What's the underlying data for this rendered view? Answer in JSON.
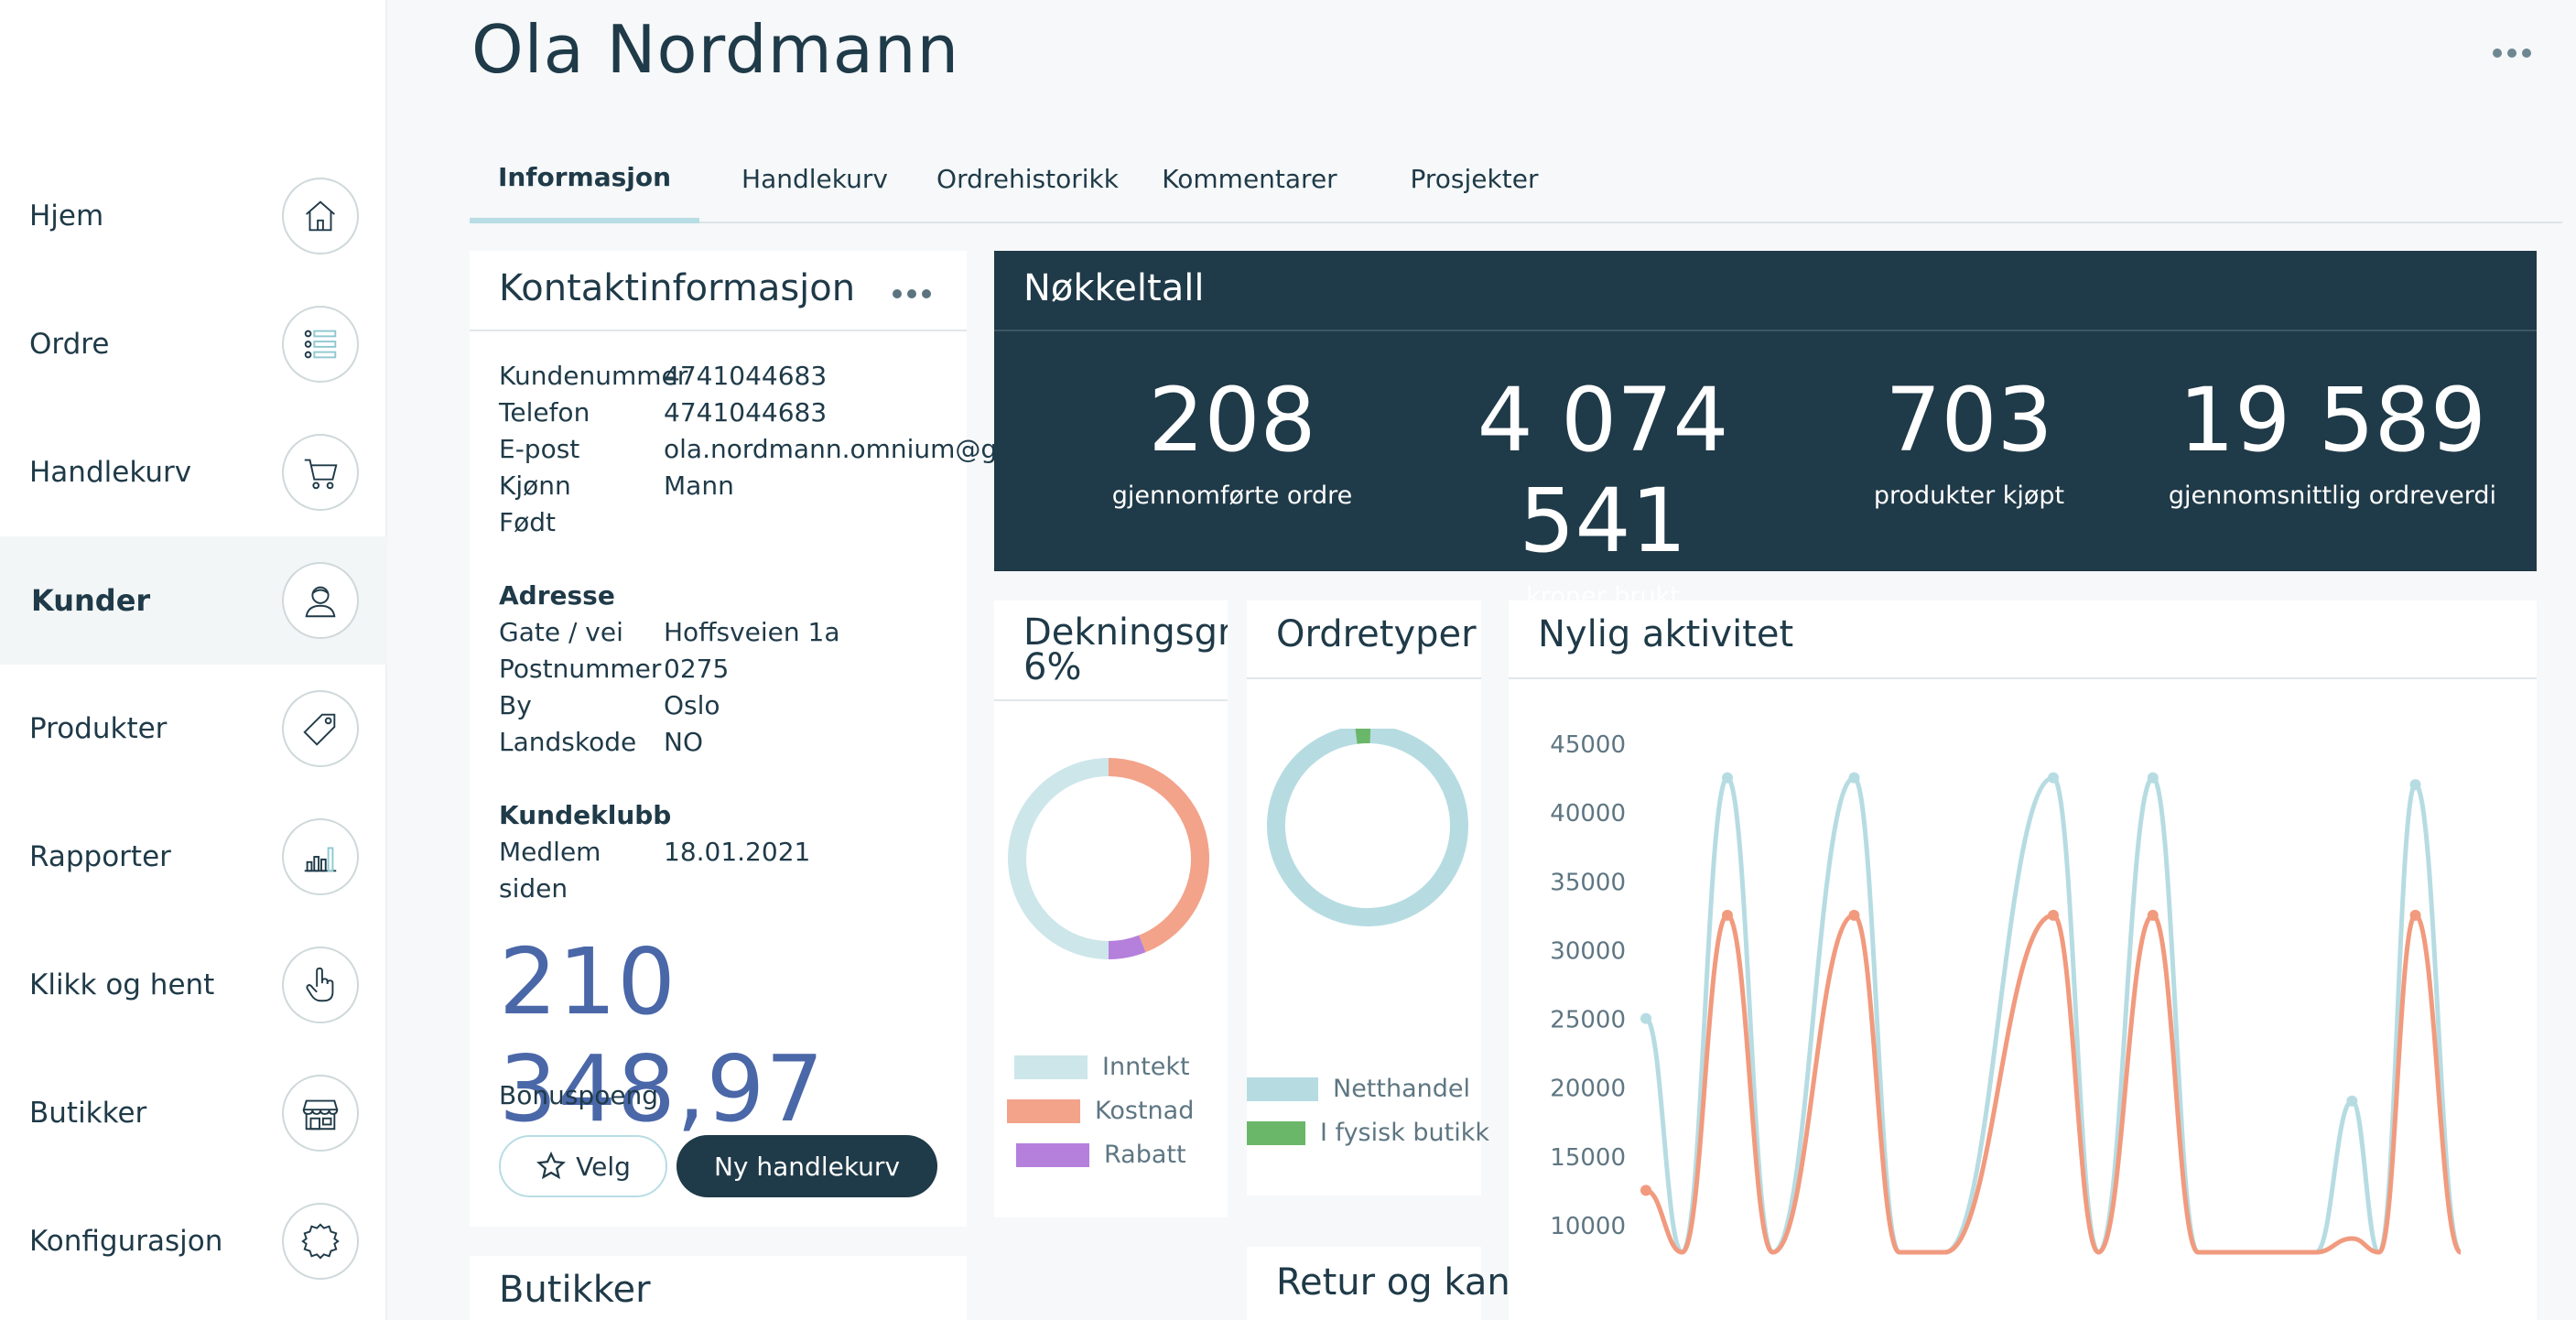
{
  "sidebar": {
    "items": [
      {
        "label": "Hjem",
        "icon": "home-icon"
      },
      {
        "label": "Ordre",
        "icon": "list-icon"
      },
      {
        "label": "Handlekurv",
        "icon": "cart-icon"
      },
      {
        "label": "Kunder",
        "icon": "customer-icon",
        "active": true
      },
      {
        "label": "Produkter",
        "icon": "tag-icon"
      },
      {
        "label": "Rapporter",
        "icon": "bar-chart-icon"
      },
      {
        "label": "Klikk og hent",
        "icon": "hand-pointer-icon"
      },
      {
        "label": "Butikker",
        "icon": "store-icon"
      },
      {
        "label": "Konfigurasjon",
        "icon": "gear-icon"
      }
    ]
  },
  "header": {
    "title": "Ola Nordmann",
    "more_icon": "more-horizontal-icon"
  },
  "tabs": [
    {
      "label": "Informasjon",
      "active": true
    },
    {
      "label": "Handlekurv"
    },
    {
      "label": "Ordrehistorikk"
    },
    {
      "label": "Kommentarer"
    },
    {
      "label": "Prosjekter"
    }
  ],
  "contact": {
    "title": "Kontaktinformasjon",
    "fields": [
      {
        "key": "Kundenummer",
        "value": "4741044683"
      },
      {
        "key": "Telefon",
        "value": "4741044683"
      },
      {
        "key": "E-post",
        "value": "ola.nordmann.omnium@gmail.com"
      },
      {
        "key": "Kjønn",
        "value": "Mann"
      },
      {
        "key": "Født",
        "value": ""
      }
    ],
    "address_heading": "Adresse",
    "address": [
      {
        "key": "Gate / vei",
        "value": "Hoffsveien 1a"
      },
      {
        "key": "Postnummer",
        "value": "0275"
      },
      {
        "key": "By",
        "value": "Oslo"
      },
      {
        "key": "Landskode",
        "value": "NO"
      }
    ],
    "club_heading": "Kundeklubb",
    "member_key_line1": "Medlem",
    "member_key_line2": "siden",
    "member_value": "18.01.2021",
    "bonus_value": "210 348,97",
    "bonus_label": "Bonuspoeng",
    "velg_label": "Velg",
    "ny_label": "Ny handlekurv"
  },
  "butikker_card": {
    "title": "Butikker"
  },
  "nokkeltall": {
    "title": "Nøkkeltall",
    "kpis": [
      {
        "value": "208",
        "label": "gjennomførte ordre"
      },
      {
        "value": "4 074 541",
        "label": "kroner brukt"
      },
      {
        "value": "703",
        "label": "produkter kjøpt"
      },
      {
        "value": "19 589",
        "label": "gjennomsnittlig ordreverdi"
      }
    ]
  },
  "dekning": {
    "title": "Dekningsgrad",
    "percent": "6%",
    "legend": [
      {
        "label": "Inntekt",
        "color": "#cde6ea"
      },
      {
        "label": "Kostnad",
        "color": "#f2a38a"
      },
      {
        "label": "Rabatt",
        "color": "#b57fdc"
      }
    ],
    "shares": [
      0.5,
      0.44,
      0.06
    ]
  },
  "ordretyper": {
    "title": "Ordretyper",
    "legend": [
      {
        "label": "Netthandel",
        "color": "#b6dce2"
      },
      {
        "label": "I fysisk butikk",
        "color": "#6bb76a"
      }
    ],
    "shares": [
      0.975,
      0.025
    ]
  },
  "retur": {
    "title": "Retur og kanselleringer"
  },
  "aktivitet": {
    "title": "Nylig aktivitet"
  },
  "chart_data": {
    "type": "line",
    "title": "Nylig aktivitet",
    "y_ticks": [
      "45000",
      "40000",
      "35000",
      "30000",
      "25000",
      "20000",
      "15000",
      "10000"
    ],
    "ylim": [
      10000,
      45000
    ],
    "grid": false,
    "series": [
      {
        "color": "#b6dce2",
        "x": [
          0,
          0.4,
          0.9,
          1.4,
          2.3,
          2.8,
          3.3,
          4.5,
          5.0,
          5.6,
          6.1,
          6.6,
          7.4,
          7.8,
          8.1,
          8.5,
          9.0
        ],
        "values": [
          25000,
          8000,
          42500,
          8000,
          42500,
          8000,
          8000,
          42500,
          8000,
          42500,
          8000,
          8000,
          8000,
          19000,
          8000,
          42000,
          8000
        ]
      },
      {
        "color": "#f19a7e",
        "x": [
          0,
          0.4,
          0.9,
          1.4,
          2.3,
          2.8,
          3.3,
          4.5,
          5.0,
          5.6,
          6.1,
          6.6,
          7.4,
          7.8,
          8.1,
          8.5,
          9.0
        ],
        "values": [
          12500,
          8000,
          32500,
          8000,
          32500,
          8000,
          8000,
          32500,
          8000,
          32500,
          8000,
          8000,
          8000,
          9000,
          8000,
          32500,
          8000
        ]
      }
    ]
  }
}
